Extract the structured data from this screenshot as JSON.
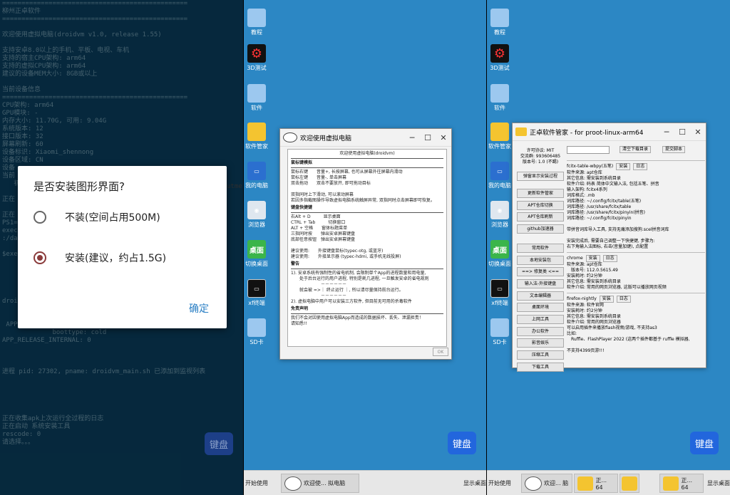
{
  "terminal": {
    "lines": [
      "================================================",
      "柳州正卓软件",
      "================================================",
      "",
      "欢迎使用虚拟电脑(droidvm v1.0, release 1.55)",
      "",
      "支持安卓8.0以上的手机、平板、电视、车机",
      "支持的宿主CPU架构: arm64",
      "支持的虚拟CPU架构: arm64",
      "建议的设备MEM大小: 8GB或以上",
      "",
      "当前设备信息",
      "================================================",
      "CPU架构: arm64",
      "GPU模块: -",
      "内存大小: 11.70G, 可用: 9.04G",
      "系统版本: 12",
      "接口版本: 32",
      "屏幕刷新: 60",
      "设备标识: Xiaomi_shennong",
      "设备区域: CN",
      "设备",
      "当前",
      "   初",
      "",
      "正在",
      "",
      "正在",
      "PS1=",
      "exec",
      ":/da",
      "",
      "$exe",
      "",
      "",
      "",
      "",
      "",
      "droi",
      "",
      "",
      " APP_",
      "             boottype: cold",
      "APP_RELEASE_INTERNAL: 0",
      "",
      "",
      "",
      "进程 pid: 27302, pname: droidvm_main.sh 已添加到监视列表",
      "",
      "",
      "",
      "",
      "",
      "正在收集apk上次运行全过程的日志",
      "正在启动 系统安装工具",
      "rescode: 0",
      "请选择。。。"
    ],
    "side_fragment": "utme"
  },
  "install_dialog": {
    "title": "是否安装图形界面?",
    "option1": "不装(空间占用500M)",
    "option2": "安装(建议，约占1.5G)",
    "selected": "option2",
    "confirm": "确定"
  },
  "keyboard_label": "键盘",
  "desktop_icons": [
    {
      "label": "教程",
      "icon": "folder-icon"
    },
    {
      "label": "3D测试",
      "icon": "gears-icon"
    },
    {
      "label": "软件",
      "icon": "folder-icon"
    },
    {
      "label": "软件管家",
      "icon": "app-store-icon"
    },
    {
      "label": "我的电脑",
      "icon": "computer-icon"
    },
    {
      "label": "浏览器",
      "icon": "browser-icon"
    },
    {
      "label": "切换桌面",
      "icon": "desktop-switch-icon"
    },
    {
      "label": "xf终端",
      "icon": "terminal-icon"
    },
    {
      "label": "SD卡",
      "icon": "sdcard-folder-icon"
    }
  ],
  "desktop_icons_switch_text": "桌面",
  "welcome_window": {
    "title": "欢迎使用虚拟电脑",
    "header": "欢迎使用虚拟电脑(droidvm)",
    "sections": [
      {
        "h": "鼠标键模拟",
        "lines": [
          "鼠标右键　　音量+, 长按屏幕, 也可从屏幕外往屏幕内滑动",
          "鼠标左键　　音量-, 单击屏幕",
          "双击拖动　　双击不要放开, 即可拖动目标",
          "",
          "双指同时上下滑动, 可以滚动屏幕",
          "若因多指截图操作导致虚拟电脑系统触屏异常, 双指同时点击屏幕即可恢复。"
        ]
      },
      {
        "h": "键盘快捷键",
        "lines": [
          "右Alt + D　　　显示桌面",
          "CTRL + Tab　　　切换窗口",
          "ALT + 空格　　窗体标题菜单",
          "三指同时按　　弹出安卓屏幕键盘",
          "底部任意按钮　弹出安卓屏幕键盘",
          "",
          "建议使用:　　外接键盘鼠标(typec-otg, 或蓝牙)",
          "建议使用:　　外接显示器 (typec-hdmi, 或手机无线投屏)"
        ]
      },
      {
        "h": "警告",
        "lines": [
          "1). 安卓系统有强制性的省电机制, 会限制单个App的进程数量和用电量,",
          "　　处于后台运行的用户进程, 特别是耗几进程, 一旦触发安卓的省电规则",
          "　　　　　　　－－－－－－",
          "　　就会被 =>｜ 终止运行 ｜, 所以请尽量保持前台运行。",
          "　　　　　　　－－－－－－",
          "2). 虚拟电脑中用户可以安装三方软件, 但目前无可用的杀毒软件"
        ]
      },
      {
        "h": "免责声明",
        "lines": [
          "我们不会对因使用虚拟电脑App而造成的数据损坏、丢失、泄漏担责！",
          "请知悉!!"
        ]
      }
    ],
    "ok": "OK"
  },
  "manager_window": {
    "title": "正卓软件管家 - for proot-linux-arm64",
    "license": "许可协议: MIT",
    "qq_group": "交流群: 993606485",
    "version": "版本号: 1.0 (不踢)",
    "popup_btn": "弹窗显示安装过程",
    "left_buttons": [
      "更新软件管家",
      "APT仓库切换",
      "APT仓库刷新",
      "github加速器",
      "常用软件",
      "本地安装包",
      "==> 修复类 <==",
      "输入法-外接键盘",
      "文本编辑器",
      "桌面环境",
      "上网工具",
      "办公软件",
      "影音娱乐",
      "压缩工具",
      "下载工具"
    ],
    "search_value": "",
    "clear_btn": "清空下载目录",
    "submit_btn": "提交脚本",
    "apps": [
      {
        "name": "fcitx-table-wbpy(五笔)",
        "install": "安装",
        "log": "日志",
        "lines": [
          "软件来源: apt仓库",
          "其它信息: 需安装到系统目录",
          "软件介绍: 码表 简体中文输入法, 包括五笔、拼音",
          "输入架构: fcitx4系列",
          "词库格式: .mb",
          "词库路径: ~/.config/fcitx/table(五笔)",
          "词库路径: /usr/share/fcitx/table",
          "词库路径: /usr/share/fcitx/pinyin(拼音)",
          "词库路径: ~/.config/fcitx/pinyin",
          "",
          "带拼音词库导入工具, 支持无痛添加搜狗.scel拼音词库",
          "",
          "安装完成后, 需要自己调整一下快捷键, 步骤为:",
          "右下角输入法图标, 右击(音量加键), 点配置"
        ]
      },
      {
        "name": "chrome",
        "install": "安装",
        "log": "日志",
        "lines": [
          "软件来源: apt仓库",
          "　版本号: 112.0.5615.49",
          "安装耗时: 约2分钟",
          "其它信息: 需安装到系统目录",
          "软件介绍: 常用的网页浏览器, 这版可以播放网页视频"
        ]
      },
      {
        "name": "firefox-nightly",
        "install": "安装",
        "log": "日志",
        "lines": [
          "软件来源: 软件官网",
          "安装耗时: 约2分钟",
          "其它信息: 需安装到系统目录",
          "软件介绍: 常用的网页浏览器",
          "可以启用插件来播放flash视频/游戏, 不支持as3",
          "比如:",
          "　Ruffle、FlashPlayer 2022 (这两个插件都基于 ruffle 模拟器,",
          "",
          "不支持4399页游!!!"
        ]
      }
    ]
  },
  "taskbar": {
    "start": "开始使用",
    "show_desktop": "显示桌面",
    "task1": "欢迎使... 拟电脑",
    "task_short": "欢迎... 脑",
    "task_64a": "正... 64",
    "task_64b": "正... 64"
  },
  "colors": {
    "accent": "#2266dd",
    "desktop": "#2c87c4",
    "terminal": "#0b4a6f",
    "radio_selected": "#8a3b3b",
    "ok_text": "#2a7fc4"
  }
}
